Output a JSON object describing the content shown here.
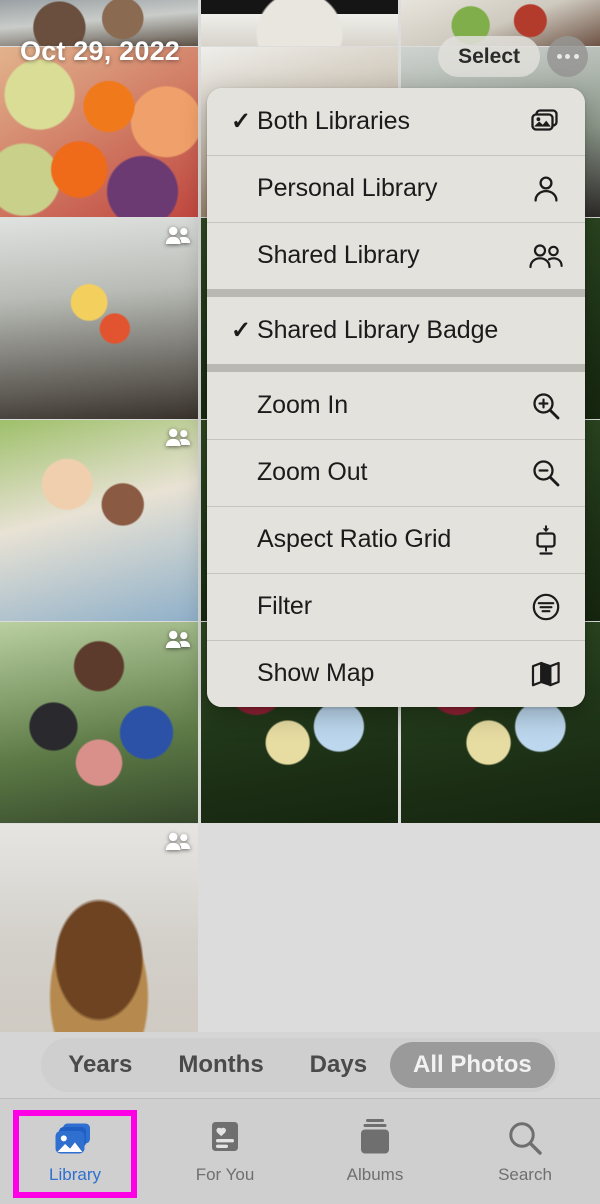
{
  "app": {
    "name": "Photos",
    "screen": "Library - All Photos"
  },
  "header": {
    "date_label": "Oct 29, 2022",
    "select_label": "Select",
    "more_icon": "ellipsis-icon"
  },
  "context_menu": {
    "groups": [
      {
        "items": [
          {
            "label": "Both Libraries",
            "checked": true,
            "icon": "photo-stack-icon"
          },
          {
            "label": "Personal Library",
            "checked": false,
            "icon": "person-icon"
          },
          {
            "label": "Shared Library",
            "checked": false,
            "icon": "two-people-icon"
          }
        ]
      },
      {
        "items": [
          {
            "label": "Shared Library Badge",
            "checked": true,
            "icon": ""
          }
        ]
      },
      {
        "items": [
          {
            "label": "Zoom In",
            "checked": false,
            "icon": "magnifier-plus-icon"
          },
          {
            "label": "Zoom Out",
            "checked": false,
            "icon": "magnifier-minus-icon"
          },
          {
            "label": "Aspect Ratio Grid",
            "checked": false,
            "icon": "aspect-ratio-icon"
          },
          {
            "label": "Filter",
            "checked": false,
            "icon": "filter-icon"
          },
          {
            "label": "Show Map",
            "checked": false,
            "icon": "map-icon"
          }
        ]
      }
    ],
    "checkmark_glyph": "✓"
  },
  "segmented_control": {
    "options": [
      "Years",
      "Months",
      "Days",
      "All Photos"
    ],
    "selected": "All Photos"
  },
  "tab_bar": {
    "tabs": [
      {
        "label": "Library",
        "icon": "photo-stack-icon",
        "active": true
      },
      {
        "label": "For You",
        "icon": "for-you-card-icon",
        "active": false
      },
      {
        "label": "Albums",
        "icon": "albums-stack-icon",
        "active": false
      },
      {
        "label": "Search",
        "icon": "magnifier-icon",
        "active": false
      }
    ]
  },
  "annotation": {
    "highlight_color": "#ff00e6",
    "highlights": "Library tab"
  },
  "colors": {
    "menu_background": "#e3e2dd",
    "menu_separator": "#b9b8b2",
    "menu_text": "#1b1b1b",
    "tabbar_background": "#cfcfcf",
    "active_tab": "#2f6fd0",
    "segment_selected": "#9a9a9a",
    "highlight": "#ff00e6"
  },
  "photo_grid": {
    "badge_icon": "shared-library-badge-icon",
    "rows": [
      [
        {
          "style": "p-people-top",
          "badge": false
        },
        {
          "style": "p-bowl",
          "badge": false
        },
        {
          "style": "p-kid",
          "badge": false
        }
      ],
      [
        {
          "style": "p-fruit",
          "badge": false
        },
        {
          "style": "p-veg",
          "badge": false
        },
        {
          "style": "p-selfie",
          "badge": false
        }
      ],
      [
        {
          "style": "p-corn",
          "badge": true
        },
        {
          "style": "p-garden",
          "badge": false
        },
        {
          "style": "p-garden",
          "badge": false
        }
      ],
      [
        {
          "style": "p-hug",
          "badge": true
        },
        {
          "style": "p-garden",
          "badge": false
        },
        {
          "style": "p-garden",
          "badge": false
        }
      ],
      [
        {
          "style": "p-family",
          "badge": true
        },
        {
          "style": "p-garden",
          "badge": false
        },
        {
          "style": "p-garden",
          "badge": false
        }
      ],
      [
        {
          "style": "p-bread",
          "badge": true
        }
      ]
    ]
  }
}
